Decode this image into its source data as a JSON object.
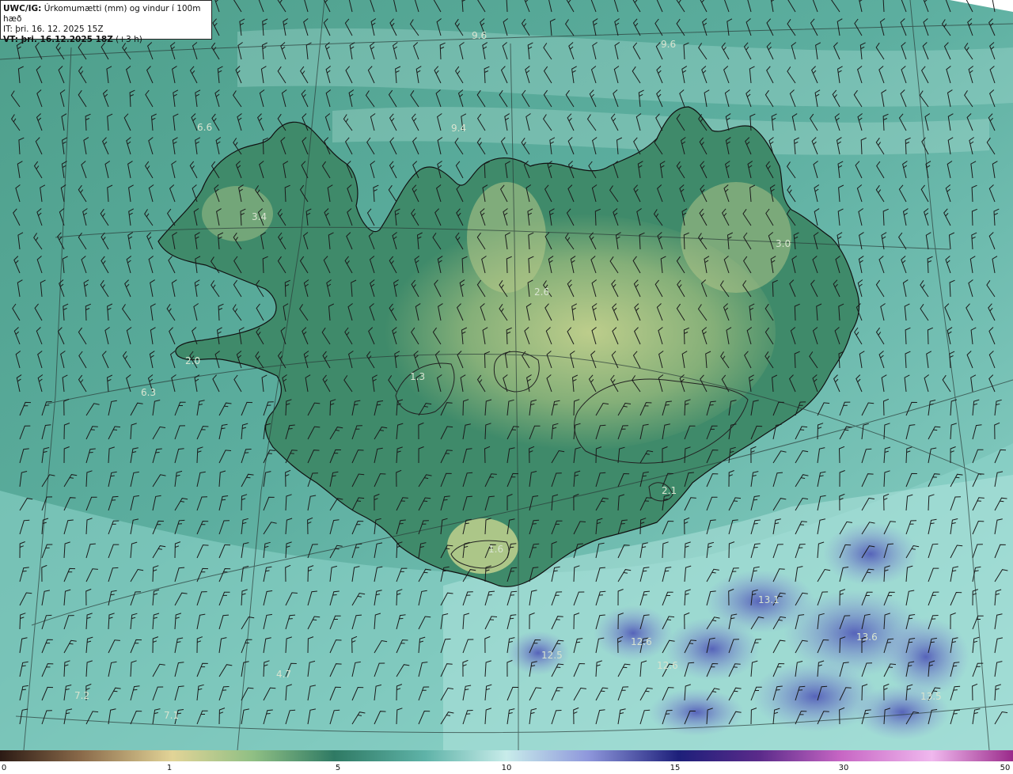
{
  "title_box": {
    "line1_bold": "UWC/IG:",
    "line1": "Úrkomumætti (mm) og vindur í 100m hæð",
    "line2_bold": "IT:",
    "line2": "þri. 16. 12. 2025 15Z",
    "line3_bold": "VT: þri. 16.12.2025 18Z",
    "line3": "(+3 h)"
  },
  "map_values": [
    "9.6",
    "9.6",
    "9.4",
    "6.6",
    "3.4",
    "3.0",
    "2.6",
    "2.0",
    "6.3",
    "1.3",
    "2.1",
    "1.6",
    "13.1",
    "13.6",
    "12.6",
    "12.5",
    "12.6",
    "13.5",
    "7.2",
    "7.1",
    "4.7"
  ],
  "colorbar": {
    "ticks": [
      "0",
      "1",
      "5",
      "10",
      "15",
      "30",
      "50"
    ],
    "tick_values": [
      0,
      1,
      5,
      10,
      15,
      30,
      50
    ]
  },
  "colors": {
    "ocean": "#5ab3a6",
    "ocean_light": "#a6dcd4",
    "land_low": "#3f8a6a",
    "land_high": "#cfd891",
    "heavy_precip": "#6a70c8",
    "barb": "#1a1a1a",
    "coast": "#111111"
  }
}
